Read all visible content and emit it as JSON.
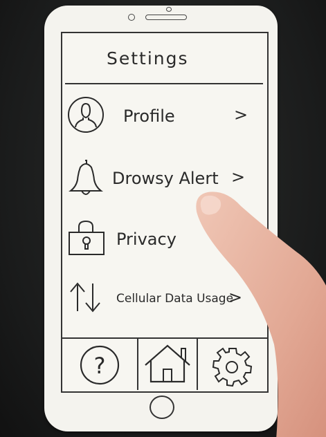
{
  "screen": {
    "title": "Settings"
  },
  "menu": {
    "items": [
      {
        "label": "Profile",
        "chevron": ">",
        "icon": "user-icon"
      },
      {
        "label": "Drowsy Alert",
        "chevron": ">",
        "icon": "bell-icon"
      },
      {
        "label": "Privacy",
        "chevron": "",
        "icon": "lock-icon"
      },
      {
        "label": "Cellular Data Usage",
        "chevron": ">",
        "icon": "data-transfer-icon"
      }
    ]
  },
  "tabbar": {
    "tabs": [
      {
        "icon": "help-icon",
        "glyph": "?"
      },
      {
        "icon": "home-icon"
      },
      {
        "icon": "gear-icon"
      }
    ]
  },
  "colors": {
    "paper": "#f4f3ee",
    "ink": "#2a2a2a",
    "background": "#1e1f1f",
    "skin": "#e9b9a6"
  }
}
